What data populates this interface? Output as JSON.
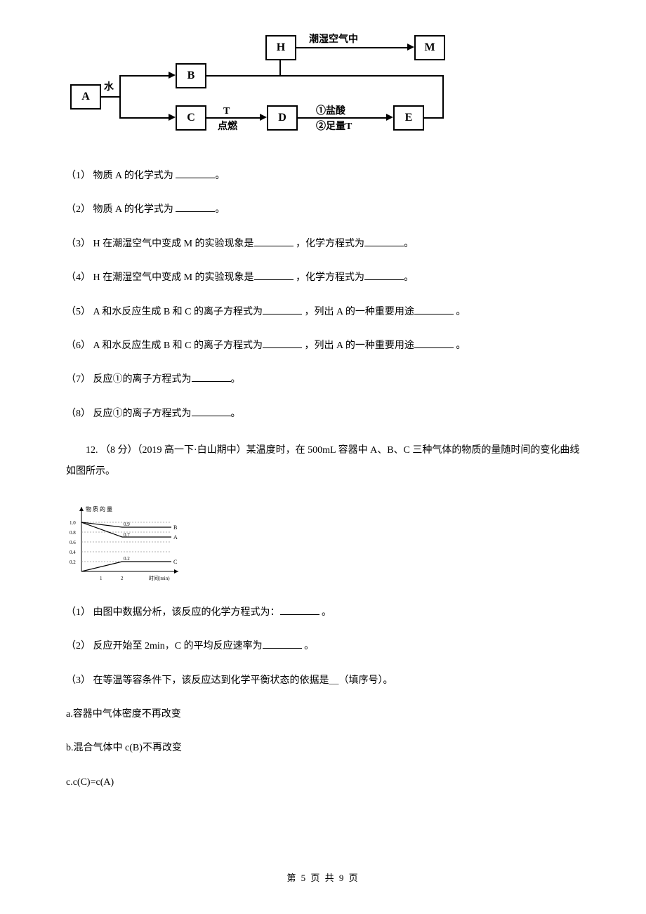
{
  "diagram": {
    "A": "A",
    "B": "B",
    "C": "C",
    "D": "D",
    "E": "E",
    "H": "H",
    "M": "M",
    "water": "水",
    "t_ignite_top": "T",
    "t_ignite_bot": "点燃",
    "moist_air": "潮湿空气中",
    "hcl": "①盐酸",
    "excess_t": "②足量T"
  },
  "q1": "（1） 物质 A 的化学式为 ",
  "q1_end": "。",
  "q2": "（2） 物质 A 的化学式为 ",
  "q2_end": "。",
  "q3a": "（3） H 在潮湿空气中变成 M 的实验现象是",
  "q3b": " ，化学方程式为",
  "q3c": "。",
  "q4a": "（4） H 在潮湿空气中变成 M 的实验现象是",
  "q4b": " ，化学方程式为",
  "q4c": "。",
  "q5a": "（5） A 和水反应生成 B 和 C 的离子方程式为",
  "q5b": " ，列出 A 的一种重要用途",
  "q5c": " 。",
  "q6a": "（6） A 和水反应生成 B 和 C 的离子方程式为",
  "q6b": " ，列出 A 的一种重要用途",
  "q6c": " 。",
  "q7": "（7） 反应①的离子方程式为",
  "q7_end": "。",
  "q8": "（8） 反应①的离子方程式为",
  "q8_end": "。",
  "q12_intro": "12. （8 分）（2019 高一下·白山期中）某温度时，在 500mL 容器中 A、B、C 三种气体的物质的量随时间的变化曲线如图所示。",
  "chart_data": {
    "type": "line",
    "ylabel": "物 质 的 量",
    "xlabel": "时间(min)",
    "x_ticks": [
      "1",
      "2"
    ],
    "y_ticks": [
      "0.2",
      "0.4",
      "0.6",
      "0.8",
      "1.0"
    ],
    "data_labels": [
      "0.2",
      "0.7",
      "0.9"
    ],
    "series": [
      {
        "name": "B",
        "x": [
          0,
          2,
          3
        ],
        "y": [
          1.0,
          0.9,
          0.9
        ]
      },
      {
        "name": "A",
        "x": [
          0,
          2,
          3
        ],
        "y": [
          1.0,
          0.7,
          0.7
        ]
      },
      {
        "name": "C",
        "x": [
          0,
          2,
          3
        ],
        "y": [
          0.0,
          0.2,
          0.2
        ]
      }
    ],
    "xlim": [
      0,
      3
    ],
    "ylim": [
      0,
      1.1
    ]
  },
  "q12_1a": "（1） 由图中数据分析，该反应的化学方程式为：",
  "q12_1b": " 。",
  "q12_2a": "（2） 反应开始至 2min，C 的平均反应速率为",
  "q12_2b": " 。",
  "q12_3": "（3） 在等温等容条件下，该反应达到化学平衡状态的依据是＿（填序号）。",
  "opt_a": "a.容器中气体密度不再改变",
  "opt_b": "b.混合气体中 c(B)不再改变",
  "opt_c": "c.c(C)=c(A)",
  "footer": "第 5 页 共 9 页"
}
